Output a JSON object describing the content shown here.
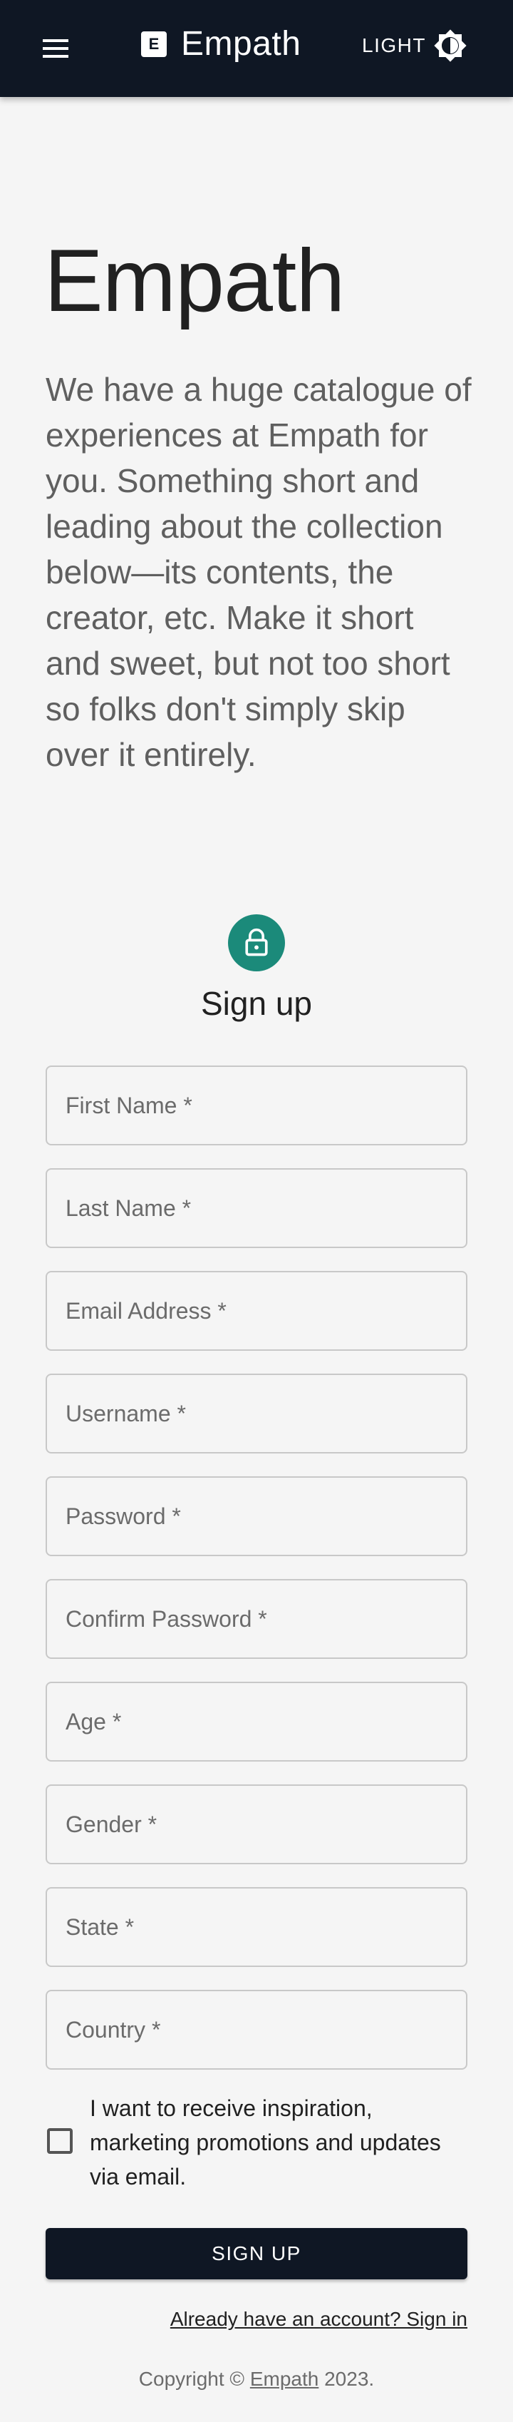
{
  "header": {
    "menu_icon": "hamburger-menu-icon",
    "brand_letter": "E",
    "brand_title": "Empath",
    "theme_label": "LIGHT",
    "theme_icon": "brightness-icon",
    "background_color": "#0f1724"
  },
  "hero": {
    "title": "Empath",
    "description": "We have a huge catalogue of experiences at Empath for you. Something short and leading about the collection below—its contents, the creator, etc. Make it short and sweet, but not too short so folks don't simply skip over it entirely."
  },
  "signup": {
    "icon": "lock-icon",
    "icon_color": "#1b8a7a",
    "heading": "Sign up",
    "fields": [
      {
        "placeholder": "First Name *"
      },
      {
        "placeholder": "Last Name *"
      },
      {
        "placeholder": "Email Address *"
      },
      {
        "placeholder": "Username *"
      },
      {
        "placeholder": "Password *"
      },
      {
        "placeholder": "Confirm Password *"
      },
      {
        "placeholder": "Age *"
      },
      {
        "placeholder": "Gender *"
      },
      {
        "placeholder": "State *"
      },
      {
        "placeholder": "Country *"
      }
    ],
    "checkbox_label": "I want to receive inspiration, marketing promotions and updates via email.",
    "checkbox_checked": false,
    "submit_label": "SIGN UP",
    "signin_link": "Already have an account? Sign in"
  },
  "footer": {
    "copyright_prefix": "Copyright ©",
    "copyright_link": "Empath",
    "copyright_year": "2023."
  }
}
